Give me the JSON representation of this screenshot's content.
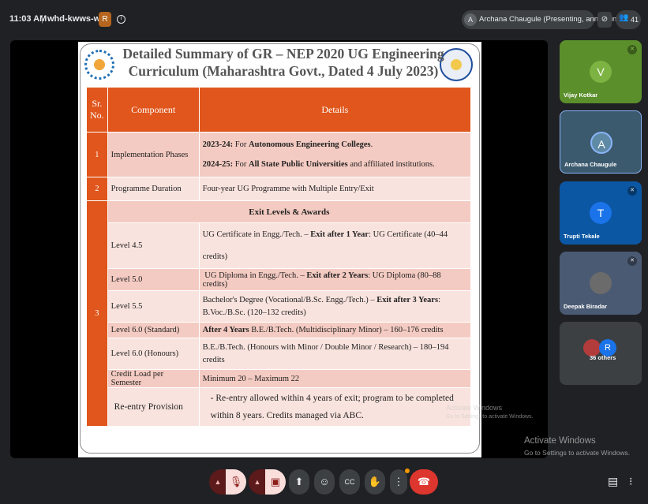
{
  "topbar": {
    "time": "11:03 AM",
    "separator": "|",
    "meeting_code": "whd-kwws-wax",
    "host_badge": "R",
    "presenting_label": "Archana Chaugule (Presenting, annotating)",
    "presenting_avatar": "A",
    "participant_count": "41",
    "icons": [
      "info-icon",
      "stop-presenting-icon",
      "people-icon"
    ]
  },
  "slide": {
    "title_line1": "Detailed Summary of GR – NEP 2020 UG Engineering",
    "title_line2": "Curriculum (Maharashtra Govt., Dated 4 July 2023)",
    "headers": {
      "sr": "Sr. No.",
      "component": "Component",
      "details": "Details"
    },
    "rows": {
      "r1_sr": "1",
      "r1_comp": "Implementation Phases",
      "r1_d1_year": "2023-24:",
      "r1_d1_for": " For ",
      "r1_d1_bold": "Autonomous Engineering Colleges",
      "r1_d1_end": ".",
      "r1_d2_year": "2024-25:",
      "r1_d2_for": " For ",
      "r1_d2_bold": "All State Public Universities",
      "r1_d2_end": " and affiliated institutions.",
      "r2_sr": "2",
      "r2_comp": "Programme Duration",
      "r2_det": "Four-year UG Programme with Multiple Entry/Exit",
      "r3_sr": "3",
      "exit_heading": "Exit Levels & Awards",
      "l45_comp": "Level 4.5",
      "l45_a": "UG Certificate in Engg./Tech. – ",
      "l45_b": "Exit after 1 Year",
      "l45_c": ": UG Certificate (40–44 credits)",
      "l50_comp": "Level 5.0",
      "l50_a": "UG Diploma in Engg./Tech. – ",
      "l50_b": "Exit after 2 Years",
      "l50_c": ": UG Diploma (80–88 credits)",
      "l55_comp": "Level 5.5",
      "l55_a": "Bachelor's Degree (Vocational/B.Sc. Engg./Tech.) – ",
      "l55_b": "Exit after 3 Years",
      "l55_c": ": B.Voc./B.Sc. (120–132 credits)",
      "l60s_comp": "Level 6.0 (Standard)",
      "l60s_b": "After 4 Years",
      "l60s_c": " B.E./B.Tech. (Multidisciplinary Minor) – 160–176 credits",
      "l60h_comp": "Level 6.0 (Honours)",
      "l60h_det": "B.E./B.Tech. (Honours with Minor / Double Minor / Research) – 180–194 credits",
      "cl_comp": "Credit Load per Semester",
      "cl_det": "Minimum 20 – Maximum 22",
      "re_comp": "Re-entry Provision",
      "re_det": "-    Re-entry allowed within 4 years of exit; program to be completed within 8 years. Credits managed via ABC."
    }
  },
  "watermark": {
    "title": "Activate Windows",
    "subtitle": "Go to Settings to activate Windows."
  },
  "participants": [
    {
      "name": "Vijay Kotkar",
      "initial": "V",
      "color": "#5a8f2b",
      "avatar_color": "#7cb342"
    },
    {
      "name": "Archana Chaugule",
      "initial": "A",
      "color": "#3c5a6e",
      "avatar_color": "#5f8aa6"
    },
    {
      "name": "Trupti Tekale",
      "initial": "T",
      "color": "#0b57a4",
      "avatar_color": "#1a73e8"
    },
    {
      "name": "Deepak Biradar",
      "initial": "",
      "color": "#4a5a73",
      "avatar_color": "#6b6b6b"
    },
    {
      "name": "36 others",
      "initial": "R",
      "color": "#3c4043",
      "avatar_color": "#1a73e8"
    }
  ],
  "controls": {
    "icons": [
      "mic-off-icon",
      "camera-off-icon",
      "present-icon",
      "emoji-icon",
      "captions-icon",
      "raise-hand-icon",
      "more-options-icon",
      "end-call-icon",
      "chat-icon",
      "activities-icon"
    ]
  }
}
